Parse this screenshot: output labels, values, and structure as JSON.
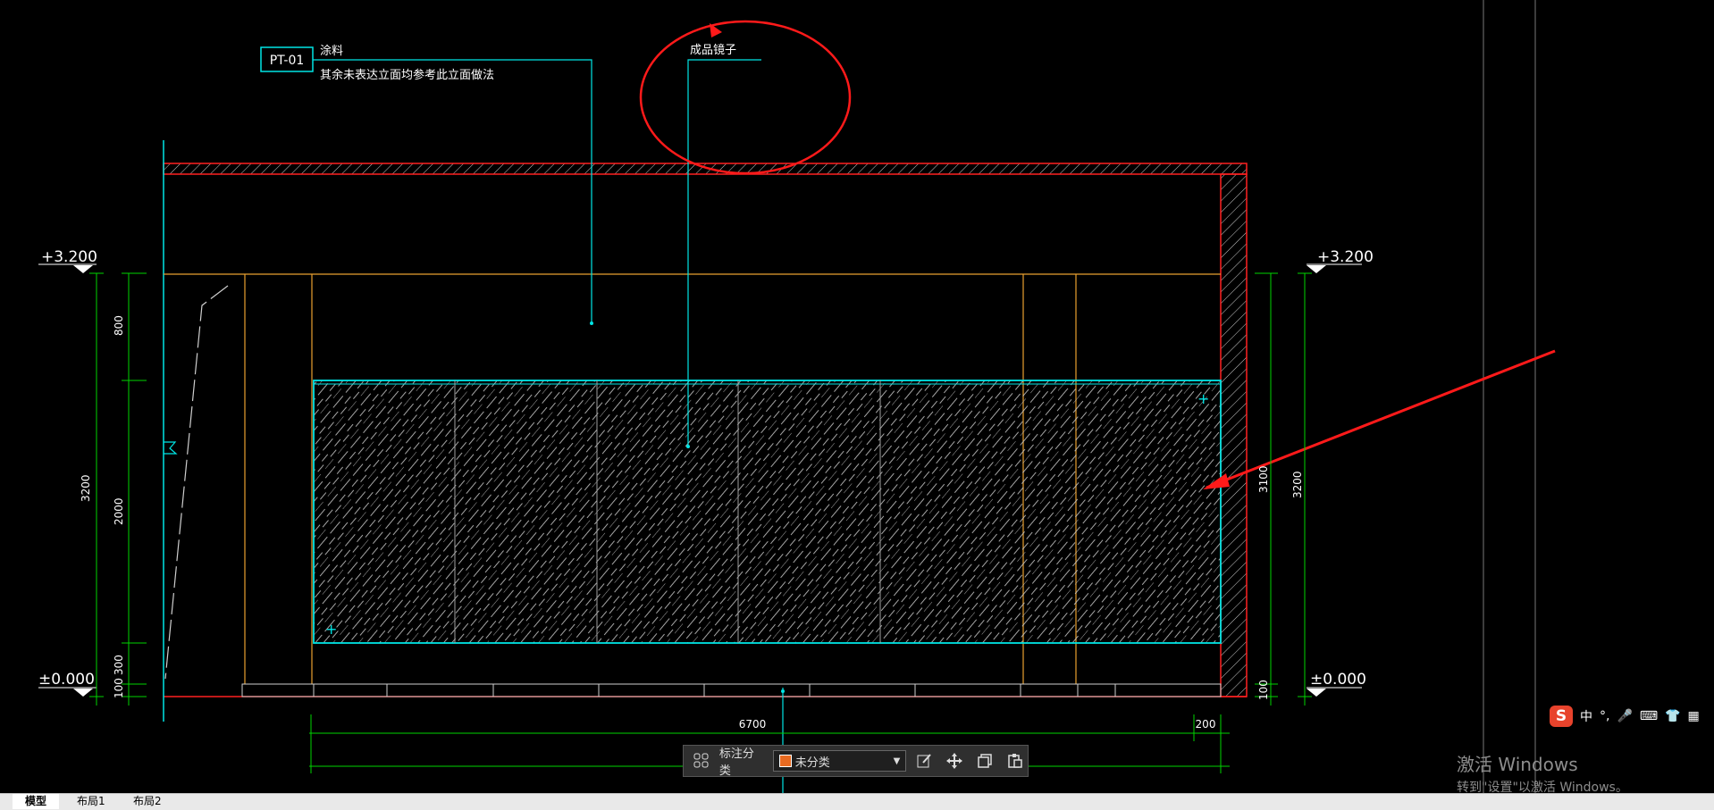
{
  "drawing": {
    "tag_code": "PT-01",
    "note_paint_line1": "涂料",
    "note_paint_line2": "其余未表达立面均参考此立面做法",
    "note_mirror": "成品镜子",
    "level_top_left": "+3.200",
    "level_bottom_left": "±0.000",
    "level_top_right": "+3.200",
    "level_bottom_right": "±0.000",
    "dim_left_800": "800",
    "dim_left_3200": "3200",
    "dim_left_2000": "2000",
    "dim_left_300": "300",
    "dim_left_100": "100",
    "dim_right_3100": "3100",
    "dim_right_3200": "3200",
    "dim_right_100": "100",
    "dim_bottom_6700": "6700",
    "dim_bottom_200": "200"
  },
  "toolbar": {
    "grid_icon": "grid-icon",
    "label": "标注分类",
    "select_value": "未分类",
    "icons": [
      "edit-icon",
      "move-icon",
      "copy-icon",
      "paste-icon"
    ]
  },
  "tabs": [
    {
      "label": "模型",
      "active": true
    },
    {
      "label": "布局1",
      "active": false
    },
    {
      "label": "布局2",
      "active": false
    }
  ],
  "ime": {
    "logo": "S",
    "items": [
      "中",
      "°,",
      "mic-icon",
      "keyboard-icon",
      "shirt-icon",
      "apps-icon"
    ]
  },
  "watermark": {
    "title": "激活 Windows",
    "subtitle": "转到\"设置\"以激活 Windows。"
  },
  "colors": {
    "background": "#000000",
    "cyan": "#00e5e5",
    "green": "#00d400",
    "orange": "#e8a030",
    "red": "#ff1a1a",
    "hatch_red": "#d92020",
    "toolbar_bg": "#2f2f2f"
  }
}
